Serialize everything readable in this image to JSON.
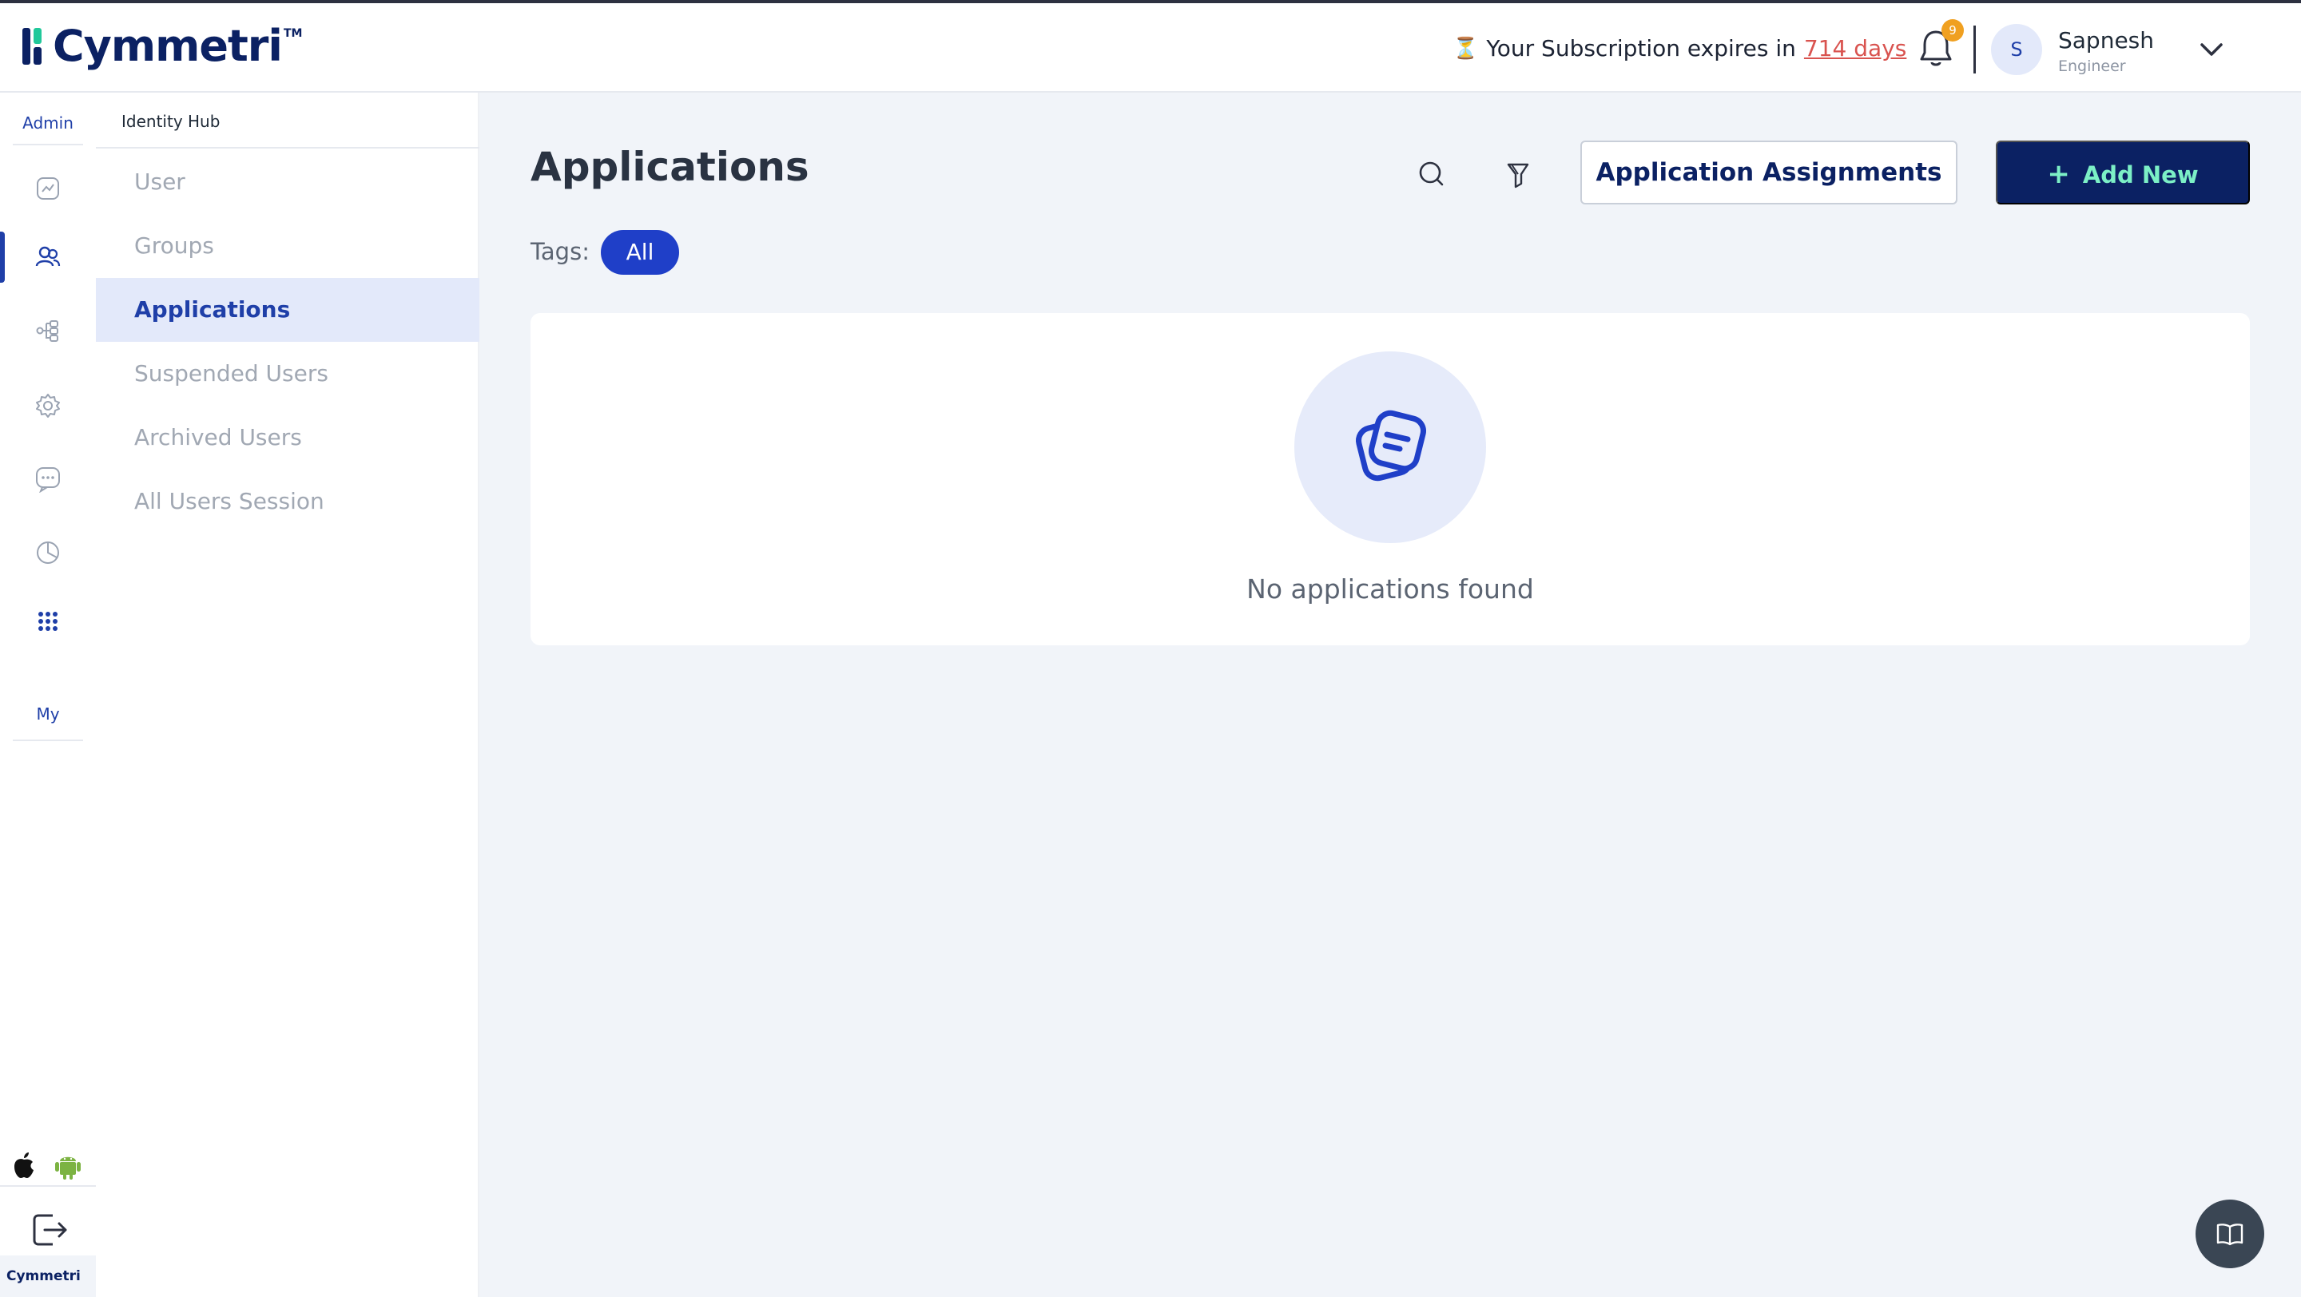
{
  "brand": {
    "name": "Cymmetri",
    "tm": "TM",
    "mini": "Cymmetri"
  },
  "header": {
    "subscription_prefix": "Your Subscription expires in",
    "subscription_days": "714 days",
    "notification_count": "9",
    "user": {
      "initial": "S",
      "name": "Sapnesh",
      "role": "Engineer"
    }
  },
  "rail": {
    "admin_label": "Admin",
    "my_label": "My",
    "icons": [
      "dashboard-icon",
      "users-icon",
      "workflow-icon",
      "settings-icon",
      "chat-icon",
      "reports-icon",
      "apps-grid-icon"
    ],
    "active_index": 1
  },
  "subnav": {
    "title": "Identity Hub",
    "items": [
      {
        "label": "User"
      },
      {
        "label": "Groups"
      },
      {
        "label": "Applications"
      },
      {
        "label": "Suspended Users"
      },
      {
        "label": "Archived Users"
      },
      {
        "label": "All Users Session"
      }
    ],
    "active_index": 2
  },
  "main": {
    "title": "Applications",
    "assignments_button": "Application Assignments",
    "add_button": "Add New",
    "tags_label": "Tags:",
    "tags": [
      "All"
    ],
    "empty_message": "No applications found"
  },
  "colors": {
    "brand_navy": "#0b2163",
    "brand_green": "#21c89a",
    "accent_blue": "#1f3fc8",
    "alert_red": "#d9534f",
    "badge_orange": "#f0a020"
  }
}
